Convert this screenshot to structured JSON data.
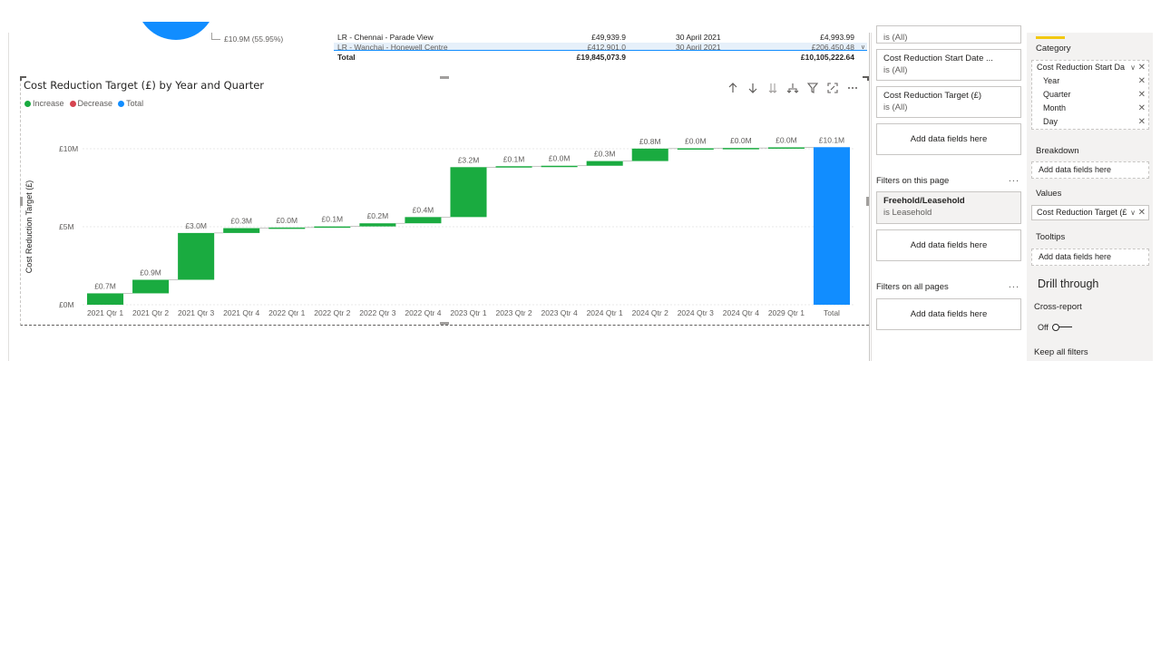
{
  "colors": {
    "increase": "#1aab40",
    "decrease": "#d64550",
    "total": "#118dff",
    "accent_yellow": "#f2c811"
  },
  "donut": {
    "label": "£10.9M (55.95%)"
  },
  "table": {
    "rows": [
      {
        "name": "LR - Chennai - Parade View",
        "value": "£49,939.9",
        "date": "30 April 2021",
        "target": "£4,993.99"
      },
      {
        "name": "LR - Wanchai - Honewell Centre",
        "value": "£412,901.0",
        "date": "30 April 2021",
        "target": "£206,450.48"
      }
    ],
    "total": {
      "label": "Total",
      "value": "£19,845,073.9",
      "target": "£10,105,222.64"
    }
  },
  "visual": {
    "title": "Cost Reduction Target (£) by Year and Quarter",
    "legend": [
      {
        "label": "Increase",
        "color": "#1aab40"
      },
      {
        "label": "Decrease",
        "color": "#d64550"
      },
      {
        "label": "Total",
        "color": "#118dff"
      }
    ],
    "toolbar": [
      "drill-up-icon",
      "drill-down-icon",
      "expand-next-level-icon",
      "expand-hierarchy-icon",
      "filter-icon",
      "focus-mode-icon",
      "more-options-icon"
    ]
  },
  "chart_data": {
    "type": "bar",
    "subtype": "waterfall",
    "title": "Cost Reduction Target (£) by Year and Quarter",
    "xlabel": "",
    "ylabel": "Cost Reduction Target (£)",
    "ylim": [
      0,
      10
    ],
    "y_ticks": [
      "£0M",
      "£5M",
      "£10M"
    ],
    "y_tick_values": [
      0,
      5,
      10
    ],
    "categories": [
      "2021 Qtr 1",
      "2021 Qtr 2",
      "2021 Qtr 3",
      "2021 Qtr 4",
      "2022 Qtr 1",
      "2022 Qtr 2",
      "2022 Qtr 3",
      "2022 Qtr 4",
      "2023 Qtr 1",
      "2023 Qtr 2",
      "2023 Qtr 4",
      "2024 Qtr 1",
      "2024 Qtr 2",
      "2024 Qtr 3",
      "2024 Qtr 4",
      "2029 Qtr 1",
      "Total"
    ],
    "values": [
      0.73,
      0.87,
      3.0,
      0.31,
      0.04,
      0.07,
      0.2,
      0.4,
      3.2,
      0.06,
      0.03,
      0.3,
      0.8,
      0.02,
      0.02,
      0.04,
      10.1
    ],
    "data_labels": [
      "£0.7M",
      "£0.9M",
      "£3.0M",
      "£0.3M",
      "£0.0M",
      "£0.1M",
      "£0.2M",
      "£0.4M",
      "£3.2M",
      "£0.1M",
      "£0.0M",
      "£0.3M",
      "£0.8M",
      "£0.0M",
      "£0.0M",
      "£0.0M",
      "£10.1M"
    ],
    "kinds": [
      "increase",
      "increase",
      "increase",
      "increase",
      "increase",
      "increase",
      "increase",
      "increase",
      "increase",
      "increase",
      "increase",
      "increase",
      "increase",
      "increase",
      "increase",
      "increase",
      "total"
    ],
    "grid": true,
    "legend_position": "top-left"
  },
  "filters": {
    "visual_cards": [
      {
        "name": "",
        "state": "is (All)"
      },
      {
        "name": "Cost Reduction Start Date ...",
        "state": "is (All)"
      },
      {
        "name": "Cost Reduction Target (£)",
        "state": "is (All)"
      }
    ],
    "add_label": "Add data fields here",
    "page_section": "Filters on this page",
    "page_card": {
      "name": "Freehold/Leasehold",
      "state": "is Leasehold"
    },
    "all_section": "Filters on all pages",
    "more": "..."
  },
  "fields": {
    "category_label": "Category",
    "category_field": "Cost Reduction Start Da",
    "category_sub": [
      "Year",
      "Quarter",
      "Month",
      "Day"
    ],
    "breakdown_label": "Breakdown",
    "values_label": "Values",
    "values_field": "Cost Reduction Target (£",
    "tooltips_label": "Tooltips",
    "add_label": "Add data fields here",
    "drill_title": "Drill through",
    "cross_report_label": "Cross-report",
    "cross_report_state": "Off",
    "keep_filters_label": "Keep all filters"
  }
}
